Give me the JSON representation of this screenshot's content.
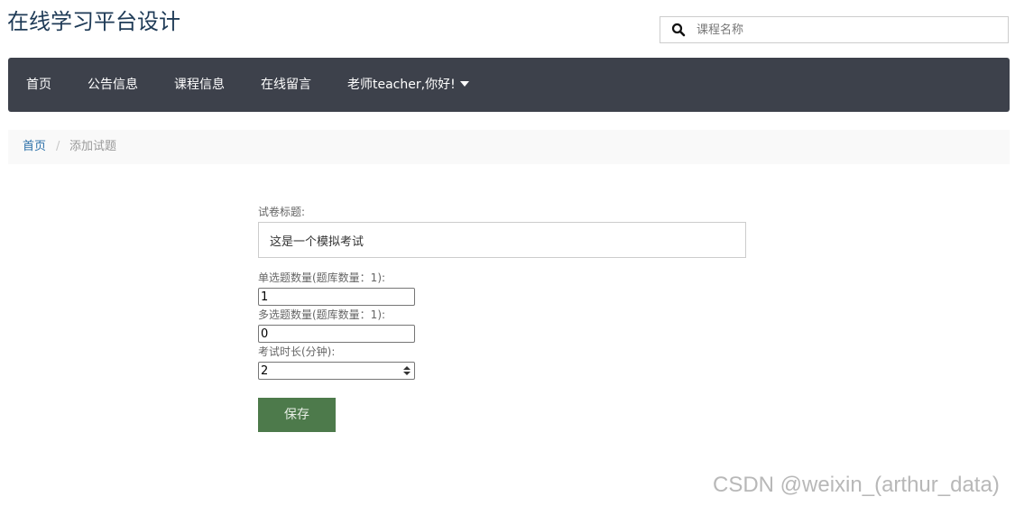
{
  "header": {
    "site_title": "在线学习平台设计",
    "search_placeholder": "课程名称"
  },
  "nav": {
    "items": [
      "首页",
      "公告信息",
      "课程信息",
      "在线留言"
    ],
    "user_menu": "老师teacher,你好!"
  },
  "breadcrumb": {
    "home": "首页",
    "separator": "/",
    "current": "添加试题"
  },
  "form": {
    "title_label": "试卷标题:",
    "title_value": "这是一个模拟考试",
    "single_label": "单选题数量(题库数量：1):",
    "single_value": "1",
    "multi_label": "多选题数量(题库数量：1):",
    "multi_value": "0",
    "duration_label": "考试时长(分钟):",
    "duration_value": "2",
    "save_label": "保存"
  },
  "watermark": "CSDN @weixin_(arthur_data)",
  "colors": {
    "navbar": "#3d414b",
    "save_button": "#4d7a4b",
    "link": "#2a6fa8"
  }
}
